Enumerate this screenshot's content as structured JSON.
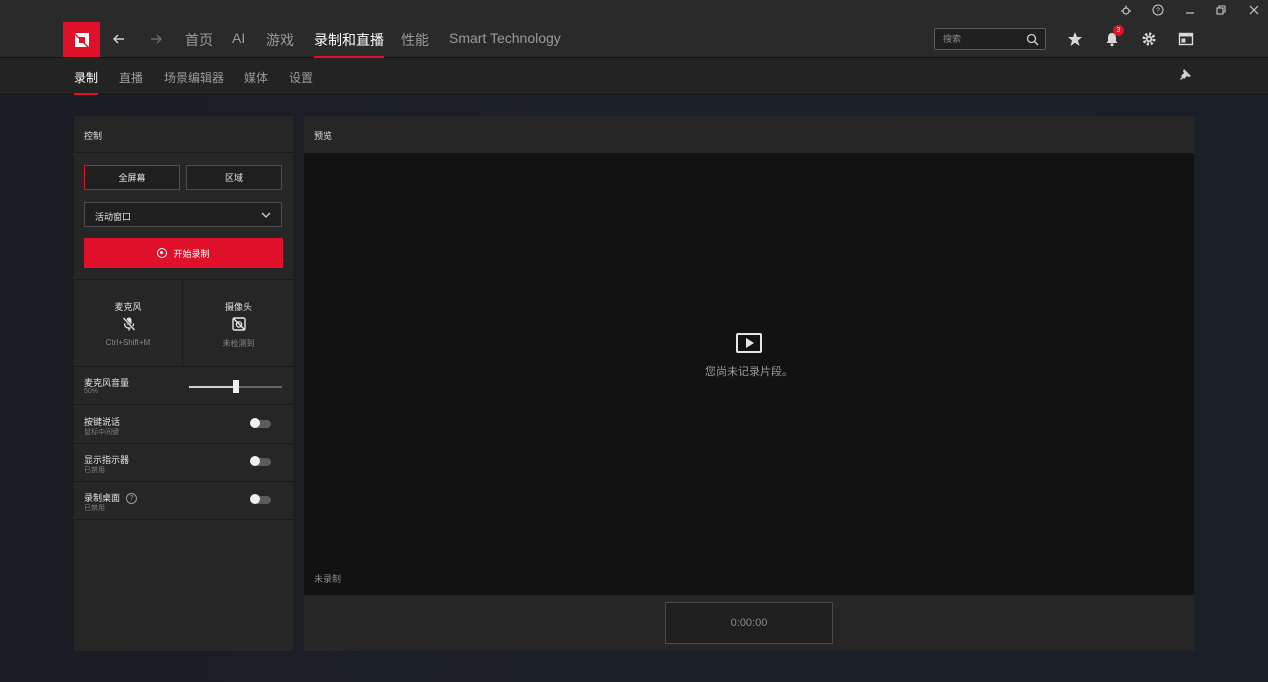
{
  "titlebar": {
    "icons": [
      "bug-icon",
      "help-icon",
      "minimize-icon",
      "restore-icon",
      "close-icon"
    ]
  },
  "nav": {
    "logo_icon": "amd-logo",
    "back_icon": "arrow-left-icon",
    "forward_icon": "arrow-right-icon",
    "items": [
      "首页",
      "AI",
      "游戏",
      "录制和直播",
      "性能",
      "Smart Technology"
    ],
    "active": "录制和直播",
    "search_placeholder": "搜索",
    "notification_count": "3",
    "right_icons": [
      "star-icon",
      "bell-icon",
      "gear-icon",
      "layout-icon"
    ]
  },
  "subnav": {
    "items": [
      "录制",
      "直播",
      "场景编辑器",
      "媒体",
      "设置"
    ],
    "active": "录制",
    "pin_icon": "pin-icon"
  },
  "control": {
    "title": "控制",
    "mode_fullscreen": "全屏幕",
    "mode_region": "区域",
    "active_mode": "全屏幕",
    "capture_source": "活动窗口",
    "record_button": "开始录制",
    "mic": {
      "label": "麦克风",
      "sub": "Ctrl+Shift+M",
      "icon": "mic-muted-icon"
    },
    "camera": {
      "label": "摄像头",
      "sub": "未检测到",
      "icon": "camera-off-icon"
    },
    "mic_volume": {
      "label": "麦克风音量",
      "value_text": "50%",
      "value": 0.5
    },
    "push_to_talk": {
      "label": "按键说话",
      "sub": "鼠标中间键",
      "on": false
    },
    "show_indicator": {
      "label": "显示指示器",
      "sub": "已禁用",
      "on": false
    },
    "record_desktop": {
      "label": "录制桌面",
      "sub": "已禁用",
      "on": false
    }
  },
  "preview": {
    "title": "预览",
    "empty_message": "您尚未记录片段。",
    "status": "未录制",
    "timer": "0:00:00"
  },
  "colors": {
    "accent": "#e0102a"
  }
}
